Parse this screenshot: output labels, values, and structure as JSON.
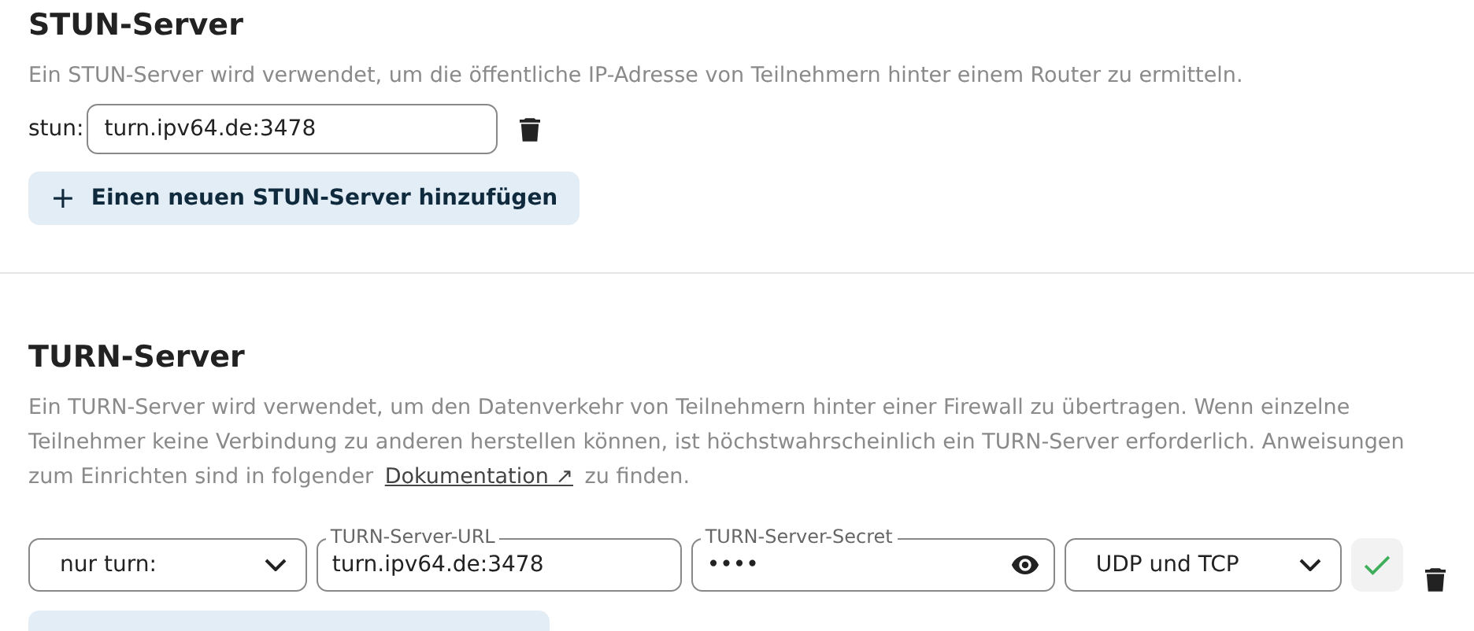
{
  "stun": {
    "title": "STUN-Server",
    "description": "Ein STUN-Server wird verwendet, um die öffentliche IP-Adresse von Teilnehmern hinter einem Router zu ermitteln.",
    "servers": [
      {
        "label": "stun:",
        "value": "turn.ipv64.de:3478"
      }
    ],
    "add_button": {
      "icon": "+",
      "label": "Einen neuen STUN-Server hinzufügen"
    }
  },
  "turn": {
    "title": "TURN-Server",
    "description_before": "Ein TURN-Server wird verwendet, um den Datenverkehr von Teilnehmern hinter einer Firewall zu übertragen. Wenn einzelne Teilnehmer keine Verbindung zu anderen herstellen können, ist höchstwahrscheinlich ein TURN-Server erforderlich. Anweisungen zum Einrichten sind in folgender",
    "link": "Dokumentation ↗",
    "description_after": "zu finden.",
    "servers": [
      {
        "scheme": "nur turn:",
        "url_label": "TURN-Server-URL",
        "url": "turn.ipv64.de:3478",
        "secret_label": "TURN-Server-Secret",
        "secret": "••••",
        "protocol": "UDP und TCP"
      }
    ]
  }
}
